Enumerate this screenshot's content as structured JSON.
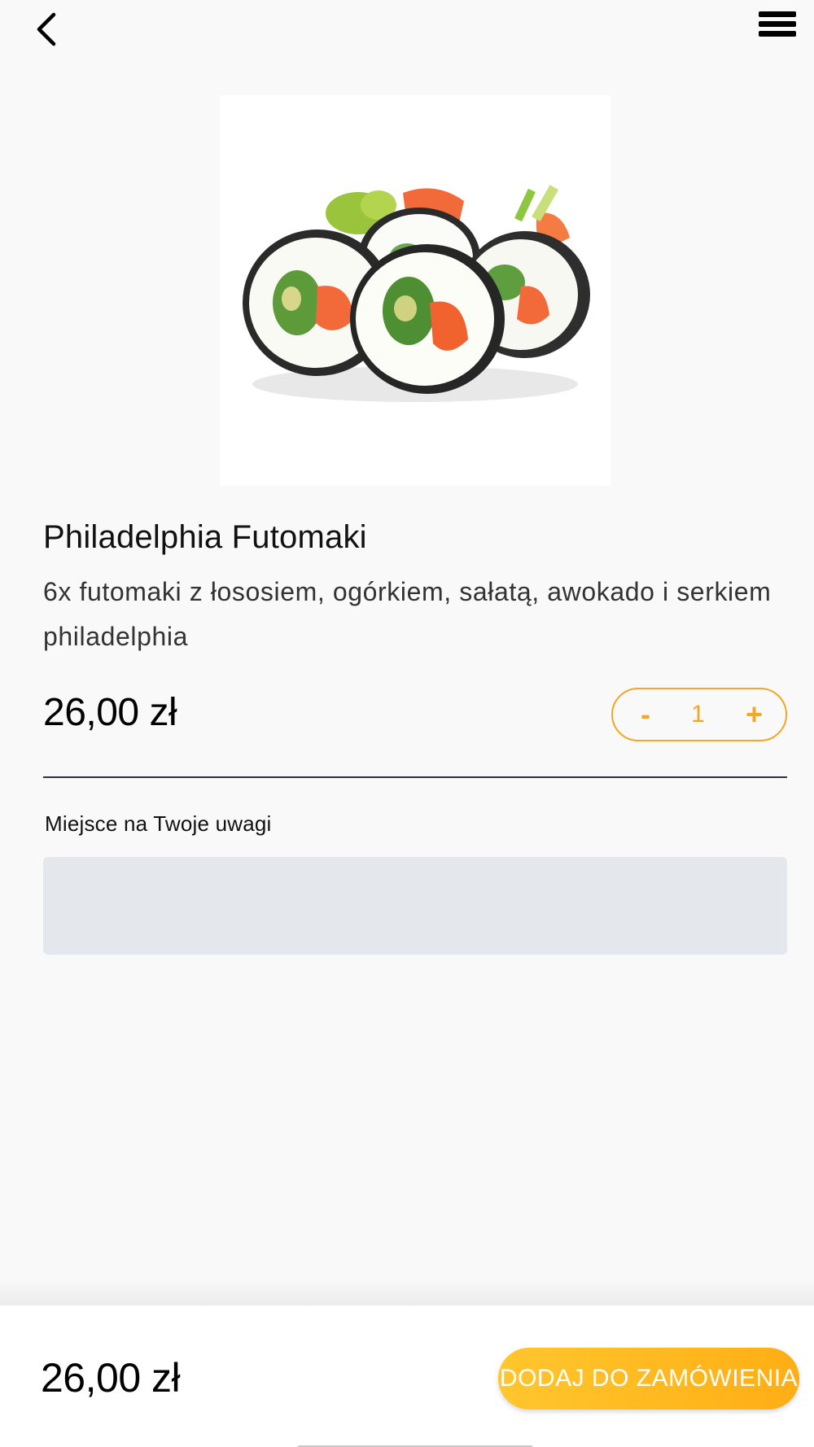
{
  "header": {
    "back_icon": "chevron-left-icon",
    "menu_icon": "hamburger-menu-icon"
  },
  "product": {
    "image_icon": "sushi-rolls-photo",
    "title": "Philadelphia Futomaki",
    "description": "6x futomaki z łososiem, ogórkiem, sałatą, awokado i serkiem philadelphia",
    "price": "26,00 zł"
  },
  "quantity": {
    "minus_label": "-",
    "value": "1",
    "plus_label": "+"
  },
  "notes": {
    "label": "Miejsce na Twoje uwagi",
    "value": ""
  },
  "footer": {
    "total": "26,00 zł",
    "add_button_label": "DODAJ DO ZAMÓWIENIA"
  },
  "colors": {
    "accent": "#f5a623",
    "button_gradient_start": "#ffc62e",
    "button_gradient_end": "#ffae14",
    "notes_bg": "#e4e7ec",
    "background": "#f9f9f9"
  }
}
